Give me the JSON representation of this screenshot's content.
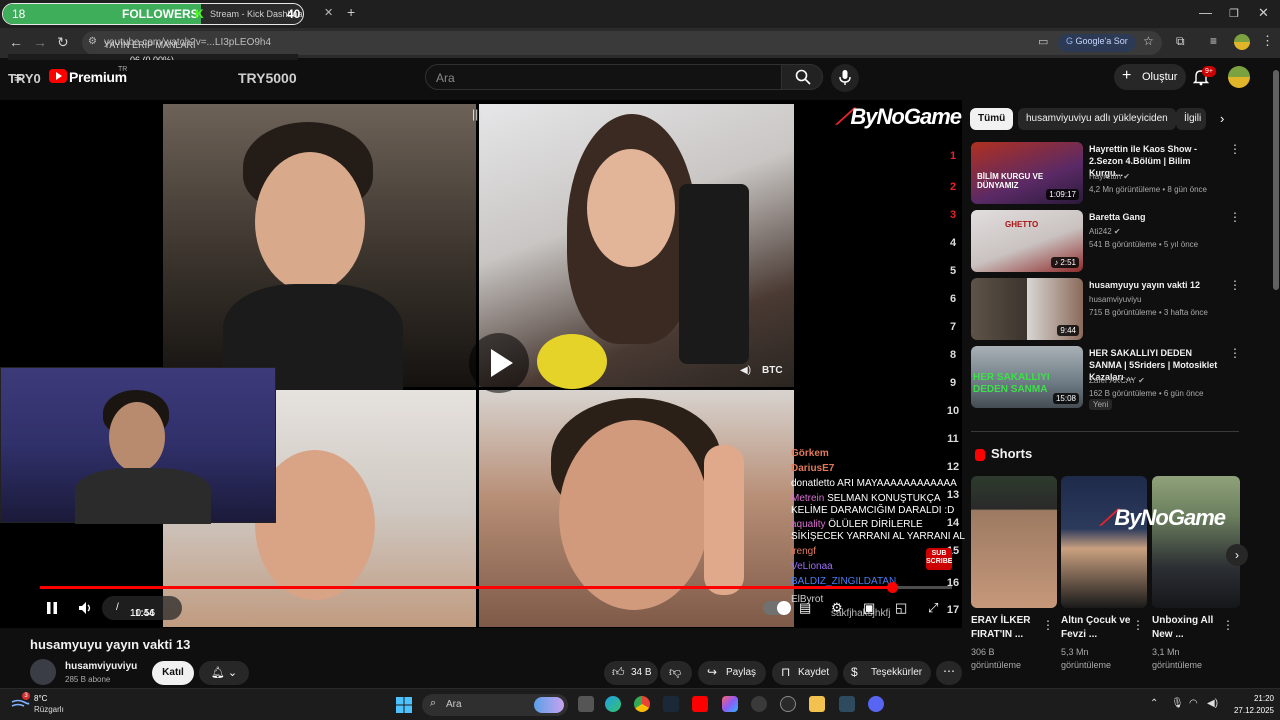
{
  "browser": {
    "tab_count_left": "18",
    "tab_title": "FOLLOWERS",
    "tab_count_right": "40",
    "tab_subtitle": "Stream - Kick Dashboa",
    "new_tab_symbol": "+",
    "url": "youtube.com/watch?v=...LI3pLEO9h4",
    "overlay_line1": "YAYIN ERİP MANLARI",
    "overlay_line2": "06 (0.00%)",
    "google_pill": "Google'a Sor"
  },
  "yt_header": {
    "left_overlay_text": "TRY0",
    "logo_text": "Premium",
    "logo_suffix": "TR",
    "right_overlay_text": "TRY5000",
    "search_placeholder": "Ara",
    "create_label": "Oluştur",
    "notif_badge": "9+"
  },
  "video": {
    "brand_logo": "ByNoGame",
    "rank_numbers": [
      "1",
      "2",
      "3",
      "4",
      "5",
      "6",
      "7",
      "8",
      "9",
      "10",
      "11",
      "12",
      "13",
      "14",
      "15",
      "16",
      "17"
    ],
    "chat": [
      {
        "user": "Görkem",
        "msg": ""
      },
      {
        "user": "DariusE7",
        "msg": ""
      },
      {
        "user": "donatletto",
        "msg": "ARI MAYAAAAAAAAAAAA"
      },
      {
        "user": "Metrein",
        "msg": "SELMAN KONUŞTUKÇA"
      },
      {
        "user": "",
        "msg": "KELİME DARAMCIĞIM DARALDI :D"
      },
      {
        "user": "aquality",
        "msg": "ÖLÜLER DİRİLERLE"
      },
      {
        "user": "",
        "msg": "SİKİŞECEK YARRANI AL YARRANI AL"
      },
      {
        "user": "irengf",
        "msg": ""
      },
      {
        "user": "VeLionaa",
        "msg": ""
      },
      {
        "user": "BALDIZ_ZINGILDATAN",
        "msg": ""
      },
      {
        "user": "ElByrot",
        "msg": ""
      },
      {
        "user": "",
        "msg": "sakfjhaksjhkfj"
      }
    ],
    "btc_label": "BTC",
    "subscribe_label": "SUB SCRIBE",
    "current_time": "10:56",
    "duration": "11:44",
    "progress_fraction": 0.934
  },
  "video_info": {
    "title": "husamyuyu yayın vakti 13",
    "channel_name": "husamviyuviyu",
    "subscribers": "285 B abone",
    "join_label": "Katıl",
    "likes": "34 B",
    "share_label": "Paylaş",
    "save_label": "Kaydet",
    "thanks_label": "Teşekkürler"
  },
  "sidebar": {
    "chips": [
      "Tümü",
      "husamviyuviyu adlı yükleyiciden",
      "İlgili"
    ],
    "videos": [
      {
        "title": "Hayrettin ile Kaos Show - 2.Sezon 4.Bölüm | Bilim Kurgu...",
        "channel": "Hayrettin",
        "meta": "4,2 Mn görüntüleme • 8 gün önce",
        "duration": "1:09:17",
        "thumb_text": "BİLİM KURGU VE DÜNYAMIZ",
        "new": ""
      },
      {
        "title": "Baretta Gang",
        "channel": "Ati242",
        "meta": "541 B görüntüleme • 5 yıl önce",
        "duration": "2:51",
        "thumb_text": "GHETTO",
        "new": ""
      },
      {
        "title": "husamyuyu yayın vakti 12",
        "channel": "husamviyuviyu",
        "meta": "715 B görüntüleme • 3 hafta önce",
        "duration": "9:44",
        "thumb_text": "",
        "new": ""
      },
      {
        "title": "HER SAKALLIYI DEDEN SANMA | 5Sriders | Motosiklet Kazaları ...",
        "channel": "Zafer AKCAY",
        "meta": "162 B görüntüleme • 6 gün önce",
        "duration": "15:08",
        "thumb_text": "HER SAKALLIYI DEDEN SANMA",
        "new": "Yeni"
      }
    ],
    "shorts_heading": "Shorts",
    "shorts": [
      {
        "title": "ERAY İLKER FIRAT'IN ...",
        "views": "306 B görüntüleme"
      },
      {
        "title": "Altın Çocuk ve Fevzi ...",
        "views": "5,3 Mn görüntüleme"
      },
      {
        "title": "Unboxing All New ...",
        "views": "3,1 Mn görüntüleme"
      }
    ],
    "shorts_brand": "ByNoGame"
  },
  "taskbar": {
    "weather_temp": "8°C",
    "weather_desc": "Rüzgarlı",
    "search_placeholder": "Ara",
    "time": "21:20",
    "date": "27.12.2025"
  }
}
